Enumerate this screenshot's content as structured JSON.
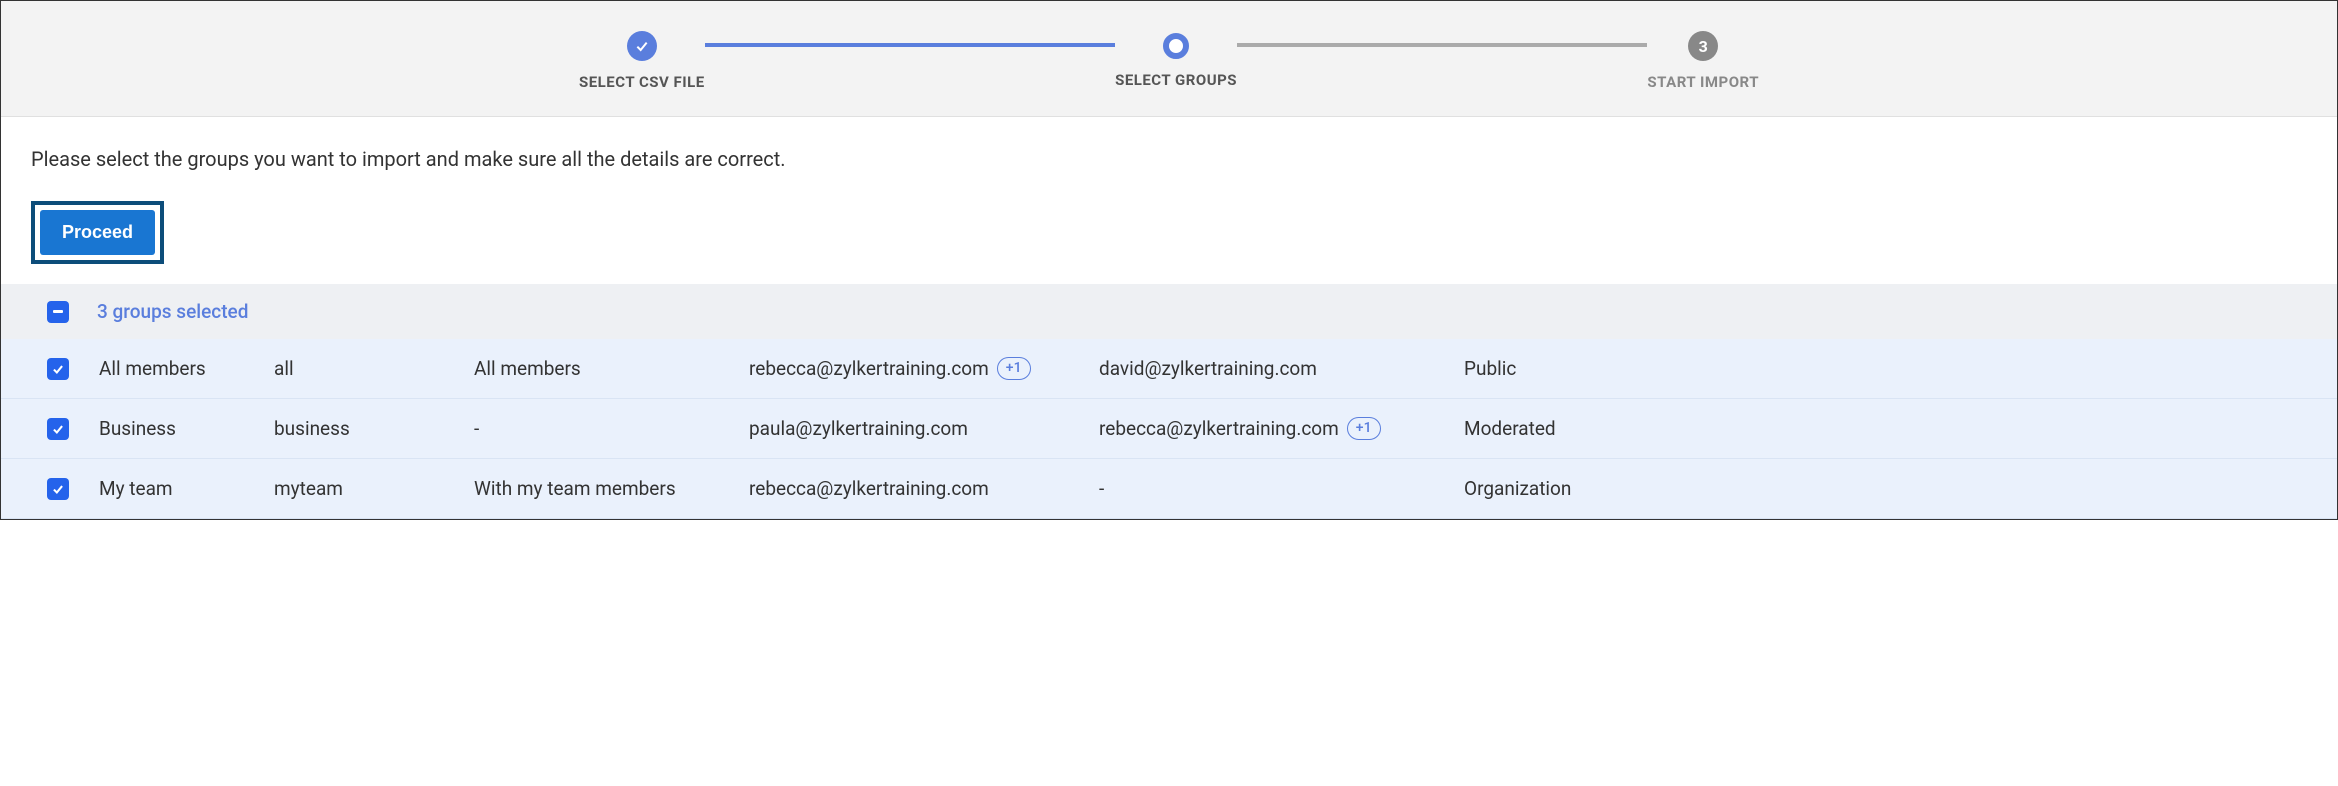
{
  "stepper": {
    "steps": [
      {
        "label": "SELECT CSV FILE",
        "state": "completed"
      },
      {
        "label": "SELECT GROUPS",
        "state": "active"
      },
      {
        "label": "START IMPORT",
        "state": "pending",
        "number": "3"
      }
    ]
  },
  "instruction": "Please select the groups you want to import and make sure all the details are correct.",
  "proceed_label": "Proceed",
  "summary": {
    "selected_text": "3 groups selected"
  },
  "rows": [
    {
      "name": "All members",
      "alias": "all",
      "desc": "All members",
      "email1": "rebecca@zylkertraining.com",
      "badge1": "+1",
      "email2": "david@zylkertraining.com",
      "badge2": "",
      "type": "Public"
    },
    {
      "name": "Business",
      "alias": "business",
      "desc": "-",
      "email1": "paula@zylkertraining.com",
      "badge1": "",
      "email2": "rebecca@zylkertraining.com",
      "badge2": "+1",
      "type": "Moderated"
    },
    {
      "name": "My team",
      "alias": "myteam",
      "desc": "With my team members",
      "email1": "rebecca@zylkertraining.com",
      "badge1": "",
      "email2": "-",
      "badge2": "",
      "type": "Organization"
    }
  ]
}
